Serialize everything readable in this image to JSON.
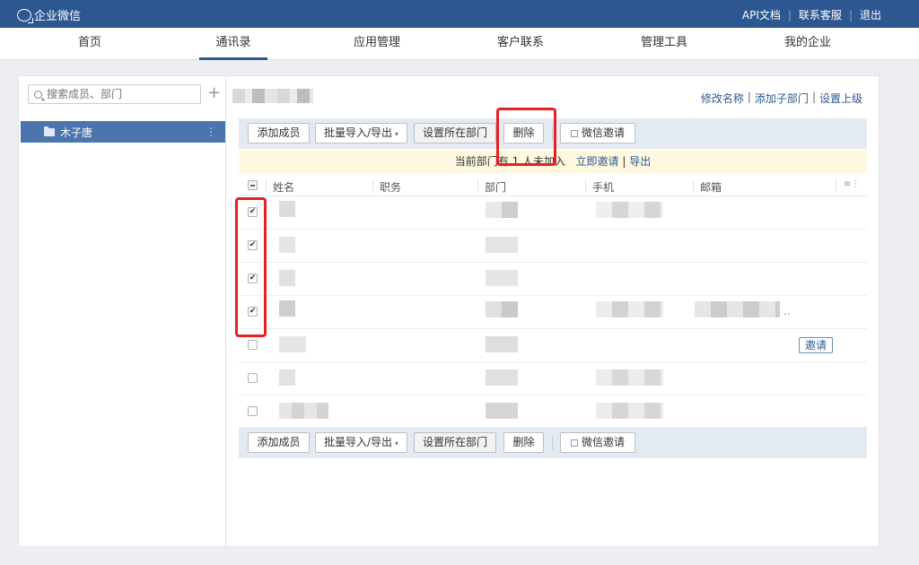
{
  "topbar": {
    "app_name": "企业微信",
    "links": [
      "API文档",
      "联系客服",
      "退出"
    ]
  },
  "nav": {
    "tabs": [
      "首页",
      "通讯录",
      "应用管理",
      "客户联系",
      "管理工具",
      "我的企业"
    ],
    "active": "通讯录"
  },
  "sidebar": {
    "search_placeholder": "搜索成员、部门",
    "plus": "+",
    "dept": "木子唐",
    "more": "⋮"
  },
  "header_links": [
    "修改名称",
    "添加子部门",
    "设置上级"
  ],
  "toolbar": {
    "add_member": "添加成员",
    "import_export": "批量导入/导出",
    "caret": "▾",
    "set_dept": "设置所在部门",
    "delete": "删除",
    "wechat_invite": "微信邀请"
  },
  "notice": {
    "prefix": "当前部门",
    "mid": "有 1 人未加入",
    "invite": "立即邀请",
    "sep": "|",
    "export": "导出"
  },
  "table": {
    "columns": [
      "姓名",
      "职务",
      "部门",
      "手机",
      "邮箱"
    ],
    "settings_icon": "≡⋮",
    "rows": [
      {
        "checked": true,
        "mark": "✔"
      },
      {
        "checked": true,
        "mark": "✔"
      },
      {
        "checked": true,
        "mark": "✔"
      },
      {
        "checked": true,
        "mark": "✔",
        "email_suffix": ".."
      },
      {
        "checked": false,
        "mark": "",
        "invite": "邀请"
      },
      {
        "checked": false,
        "mark": ""
      },
      {
        "checked": false,
        "mark": ""
      }
    ]
  },
  "colors": {
    "brand": "#2d5790",
    "highlight": "#e42222",
    "notice_bg": "#fdf8df",
    "toolbar_bg": "#e4eaf2"
  }
}
